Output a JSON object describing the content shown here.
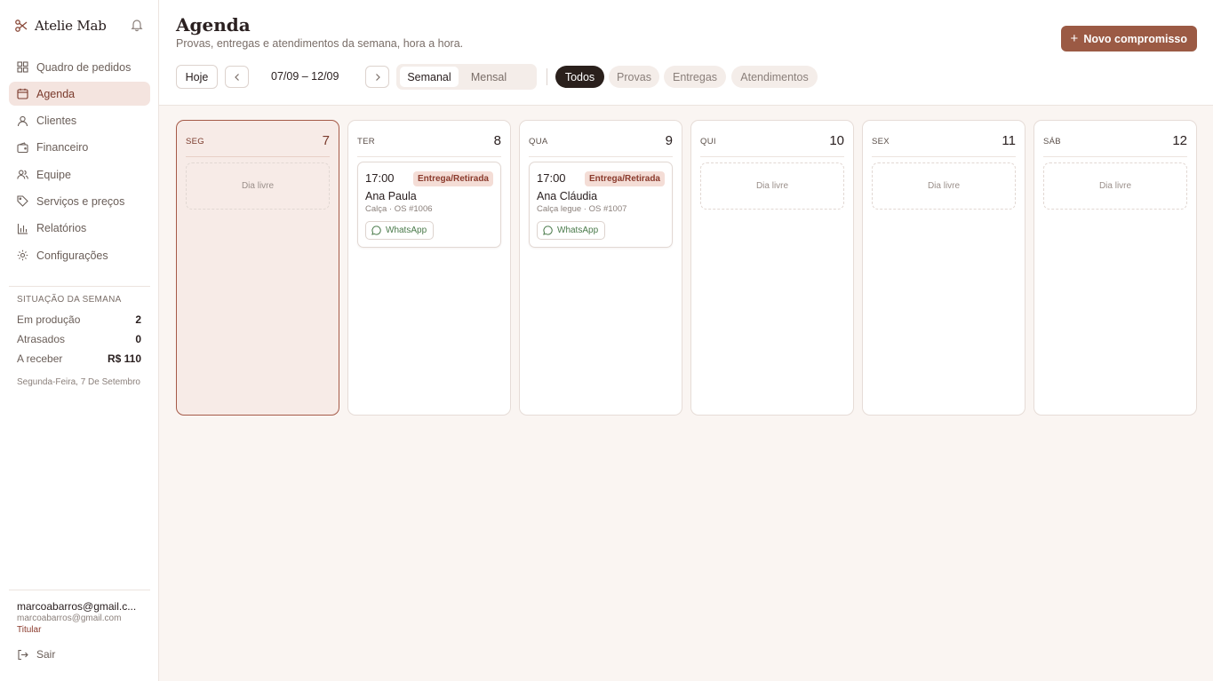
{
  "app": {
    "name": "Atelie Mab"
  },
  "sidebar": {
    "items": [
      {
        "label": "Quadro de pedidos",
        "icon": "grid-icon"
      },
      {
        "label": "Agenda",
        "icon": "calendar-icon",
        "active": true
      },
      {
        "label": "Clientes",
        "icon": "user-icon"
      },
      {
        "label": "Financeiro",
        "icon": "wallet-icon"
      },
      {
        "label": "Equipe",
        "icon": "users-icon"
      },
      {
        "label": "Serviços e preços",
        "icon": "tag-icon"
      },
      {
        "label": "Relatórios",
        "icon": "bar-chart-icon"
      },
      {
        "label": "Configurações",
        "icon": "gear-icon"
      }
    ],
    "summary": {
      "title": "SITUAÇÃO DA SEMANA",
      "rows": [
        {
          "label": "Em produção",
          "value": "2"
        },
        {
          "label": "Atrasados",
          "value": "0"
        },
        {
          "label": "A receber",
          "value": "R$ 110"
        }
      ],
      "date": "Segunda-Feira, 7 De Setembro"
    },
    "user": {
      "display": "marcoabarros@gmail.c...",
      "email": "marcoabarros@gmail.com",
      "role": "Titular"
    },
    "logout_label": "Sair"
  },
  "header": {
    "title": "Agenda",
    "subtitle": "Provas, entregas e atendimentos da semana, hora a hora.",
    "new_button": "Novo compromisso"
  },
  "toolbar": {
    "today": "Hoje",
    "range": "07/09 – 12/09",
    "views": [
      "Semanal",
      "Mensal"
    ],
    "active_view": "Semanal",
    "filters": [
      "Todos",
      "Provas",
      "Entregas",
      "Atendimentos"
    ],
    "active_filter": "Todos"
  },
  "week": {
    "free_label": "Dia livre",
    "days": [
      {
        "name": "SEG",
        "num": "7",
        "today": true,
        "events": []
      },
      {
        "name": "TER",
        "num": "8",
        "events": [
          {
            "time": "17:00",
            "tag": "Entrega/Retirada",
            "client": "Ana Paula",
            "detail": "Calça · OS #1006",
            "action": "WhatsApp"
          }
        ]
      },
      {
        "name": "QUA",
        "num": "9",
        "events": [
          {
            "time": "17:00",
            "tag": "Entrega/Retirada",
            "client": "Ana Cláudia",
            "detail": "Calça legue · OS #1007",
            "action": "WhatsApp"
          }
        ]
      },
      {
        "name": "QUI",
        "num": "10",
        "events": []
      },
      {
        "name": "SEX",
        "num": "11",
        "events": []
      },
      {
        "name": "SÁB",
        "num": "12",
        "events": []
      }
    ]
  },
  "colors": {
    "accent": "#9b5a44",
    "today_bg": "#f7ebe7",
    "active_pill": "#2a201c"
  }
}
